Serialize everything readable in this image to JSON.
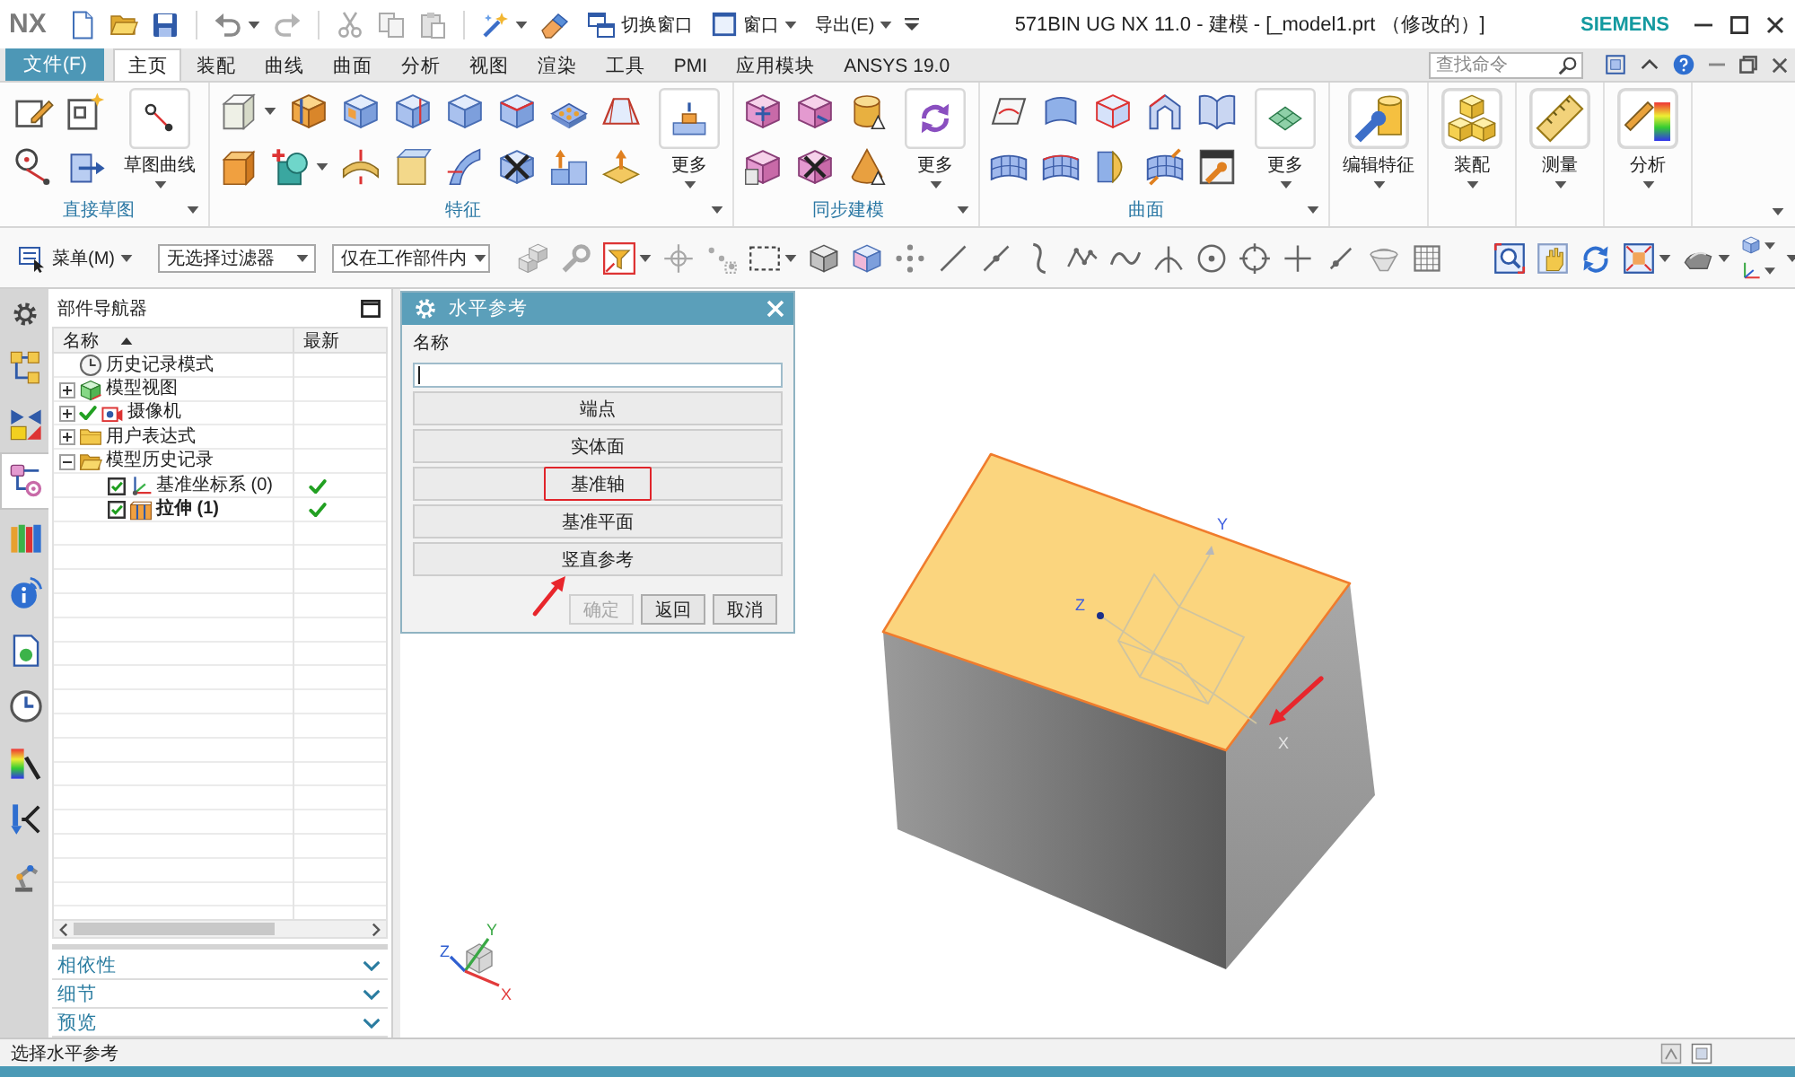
{
  "title_bar": {
    "logo": "NX",
    "switch_window": "切换窗口",
    "window_menu": "窗口",
    "export_menu": "导出(E)",
    "title": "571BIN UG NX 11.0 - 建模 - [_model1.prt （修改的）]",
    "brand": "SIEMENS"
  },
  "menu_bar": {
    "file_button": "文件(F)",
    "tabs": [
      {
        "label": "主页",
        "selected": true
      },
      {
        "label": "装配",
        "selected": false
      },
      {
        "label": "曲线",
        "selected": false
      },
      {
        "label": "曲面",
        "selected": false
      },
      {
        "label": "分析",
        "selected": false
      },
      {
        "label": "视图",
        "selected": false
      },
      {
        "label": "渲染",
        "selected": false
      },
      {
        "label": "工具",
        "selected": false
      },
      {
        "label": "PMI",
        "selected": false
      },
      {
        "label": "应用模块",
        "selected": false
      },
      {
        "label": "ANSYS 19.0",
        "selected": false
      }
    ],
    "search": {
      "placeholder": "查找命令"
    }
  },
  "ribbon": {
    "groups": [
      {
        "label": "直接草图",
        "button": "草图曲线"
      },
      {
        "label": "特征",
        "button": "更多"
      },
      {
        "label": "同步建模",
        "button": "更多"
      },
      {
        "label": "曲面",
        "button": "更多"
      }
    ],
    "large_buttons": [
      "编辑特征",
      "装配",
      "测量",
      "分析"
    ]
  },
  "toolbar": {
    "menu_button": "菜单(M)",
    "filters": [
      "无选择过滤器",
      "仅在工作部件内"
    ]
  },
  "resource_bar": {
    "tabs": [
      {
        "selected": false
      },
      {
        "selected": false
      },
      {
        "selected": true
      },
      {
        "selected": false
      },
      {
        "selected": false
      },
      {
        "selected": false
      },
      {
        "selected": false
      },
      {
        "selected": false
      },
      {
        "selected": false
      },
      {
        "selected": false
      }
    ]
  },
  "part_navigator": {
    "title": "部件导航器",
    "columns": [
      {
        "label": "名称",
        "sort_ascending": true
      },
      {
        "label": "最新"
      }
    ],
    "items": [
      {
        "kind": "history_mode",
        "label": "历史记录模式",
        "ticked": false
      },
      {
        "kind": "model_views",
        "label": "模型视图",
        "expanded": false,
        "ticked": false
      },
      {
        "kind": "cameras",
        "label": "摄像机",
        "expanded": false,
        "ticked": true
      },
      {
        "kind": "folder",
        "label": "用户表达式",
        "expanded": false,
        "ticked": false
      },
      {
        "kind": "folder",
        "label": "模型历史记录",
        "expanded": true,
        "ticked": false,
        "children": [
          {
            "kind": "datum_csys",
            "label": "基准坐标系 (0)",
            "checked": true,
            "latest": true,
            "current": false
          },
          {
            "kind": "extrude",
            "label": "拉伸 (1)",
            "checked": true,
            "latest": true,
            "current": true
          }
        ]
      }
    ],
    "sections": [
      {
        "label": "相依性",
        "expanded": false
      },
      {
        "label": "细节",
        "expanded": false
      },
      {
        "label": "预览",
        "expanded": false
      }
    ]
  },
  "dialog": {
    "title": "水平参考",
    "name_label": "名称",
    "name_field": {
      "focused": true
    },
    "buttons": [
      {
        "label": "端点",
        "highlighted": false
      },
      {
        "label": "实体面",
        "highlighted": false
      },
      {
        "label": "基准轴",
        "highlighted": true
      },
      {
        "label": "基准平面",
        "highlighted": false
      },
      {
        "label": "竖直参考",
        "highlighted": false
      }
    ],
    "footer_buttons": [
      {
        "label": "确定",
        "disabled": true
      },
      {
        "label": "返回",
        "disabled": false
      },
      {
        "label": "取消",
        "disabled": false
      }
    ]
  },
  "viewport": {
    "datum_labels": [
      "Y",
      "Z",
      "X"
    ],
    "triad": [
      {
        "label": "Y",
        "color": "#3aa845"
      },
      {
        "label": "Z",
        "color": "#2f5fd0"
      },
      {
        "label": "X",
        "color": "#e23b3b"
      }
    ]
  },
  "status_bar": {
    "message": "选择水平参考"
  }
}
